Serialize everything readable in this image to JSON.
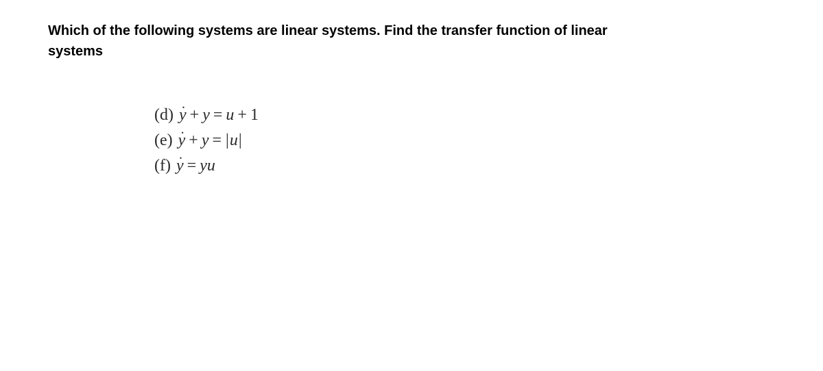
{
  "question": {
    "line1": "Which of the following systems are linear systems. Find the transfer function of linear",
    "line2": "systems"
  },
  "equations": {
    "d": {
      "label": "(d)",
      "var1": "y",
      "plus": "+",
      "var2": "y",
      "equals": "=",
      "var3": "u",
      "plus2": "+",
      "const": "1"
    },
    "e": {
      "label": "(e)",
      "var1": "y",
      "plus": "+",
      "var2": "y",
      "equals": "=",
      "bar1": "|",
      "var3": "u",
      "bar2": "|"
    },
    "f": {
      "label": "(f)",
      "var1": "y",
      "equals": "=",
      "var2": "y",
      "var3": "u"
    }
  }
}
